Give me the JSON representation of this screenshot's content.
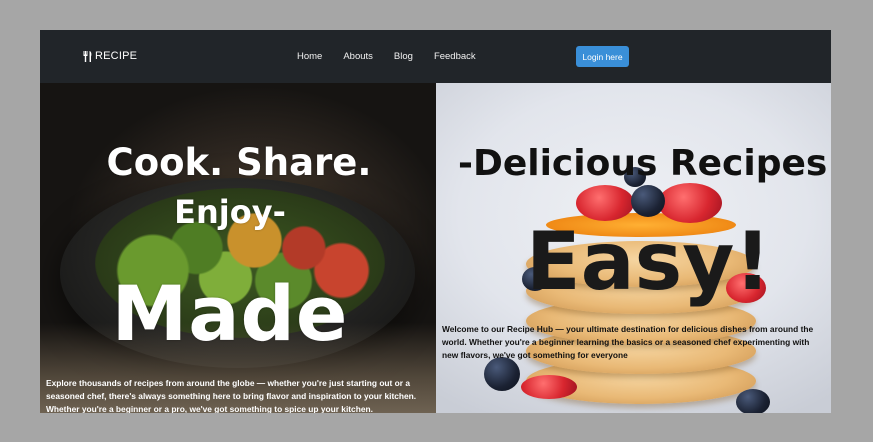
{
  "navbar": {
    "brand": "RECIPE",
    "links": [
      "Home",
      "Abouts",
      "Blog",
      "Feedback"
    ],
    "login_label": "Login here"
  },
  "hero_left": {
    "line1": "Cook. Share.",
    "line2": "Enjoy-",
    "line3": "Made",
    "description": "Explore thousands of recipes from around the globe — whether you're just starting out or a seasoned chef, there's always something here to bring flavor and inspiration to your kitchen. Whether you're a beginner or a pro, we've got something to spice up your kitchen."
  },
  "hero_right": {
    "line1": "-Delicious Recipes",
    "line2": "Easy!",
    "description": "Welcome to our Recipe Hub — your ultimate destination for delicious dishes from around the world. Whether you're a beginner learning the basics or a seasoned chef experimenting with new flavors, we've got something for everyone"
  },
  "colors": {
    "navbar_bg": "#212529",
    "login_button_bg": "#3a8fd8",
    "page_bg": "#a6a6a6"
  }
}
